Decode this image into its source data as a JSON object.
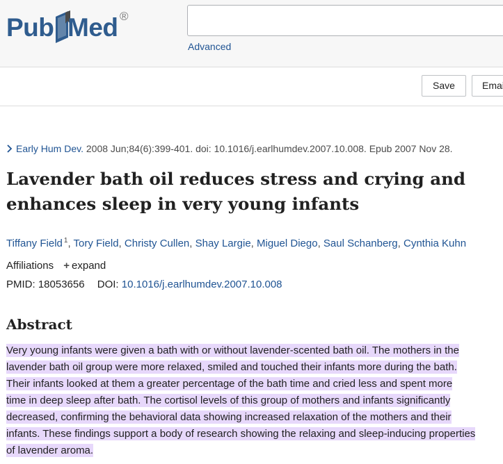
{
  "header": {
    "logo_text_left": "Pub",
    "logo_text_right": "Med",
    "logo_mark": "®",
    "search_value": "",
    "search_placeholder": "",
    "advanced_label": "Advanced"
  },
  "actions": {
    "save_label": "Save",
    "email_label": "Email"
  },
  "article": {
    "journal": "Early Hum Dev.",
    "citation_rest": " 2008 Jun;84(6):399-401. doi: 10.1016/j.earlhumdev.2007.10.008. Epub 2007 Nov 28.",
    "title": "Lavender bath oil reduces stress and crying and enhances sleep in very young infants",
    "authors": [
      {
        "name": "Tiffany Field",
        "sup": "1"
      },
      {
        "name": "Tory Field"
      },
      {
        "name": "Christy Cullen"
      },
      {
        "name": "Shay Largie"
      },
      {
        "name": "Miguel Diego"
      },
      {
        "name": "Saul Schanberg"
      },
      {
        "name": "Cynthia Kuhn"
      }
    ],
    "author_separator": ", ",
    "affiliations_label": "Affiliations",
    "expand_label": "expand",
    "pmid_label": "PMID:",
    "pmid": "18053656",
    "doi_label": "DOI:",
    "doi": "10.1016/j.earlhumdev.2007.10.008"
  },
  "abstract": {
    "heading": "Abstract",
    "lines": [
      "Very young infants were given a bath with or without lavender-scented bath oil. The mothers in the",
      "lavender bath oil group were more relaxed, smiled and touched their infants more during the bath.",
      "Their infants looked at them a greater percentage of the bath time and cried less and spent more",
      "time in deep sleep after bath. The cortisol levels of this group of mothers and infants significantly",
      "decreased, confirming the behavioral data showing increased relaxation of the mothers and their",
      "infants. These findings support a body of research showing the relaxing and sleep-inducing properties",
      "of lavender aroma."
    ]
  },
  "colors": {
    "link": "#205493",
    "logo": "#2f5c8e",
    "highlight": "#e7d8fb"
  },
  "icons": {
    "journal_chevron": "chevron-right-icon",
    "expand": "plus-icon"
  }
}
